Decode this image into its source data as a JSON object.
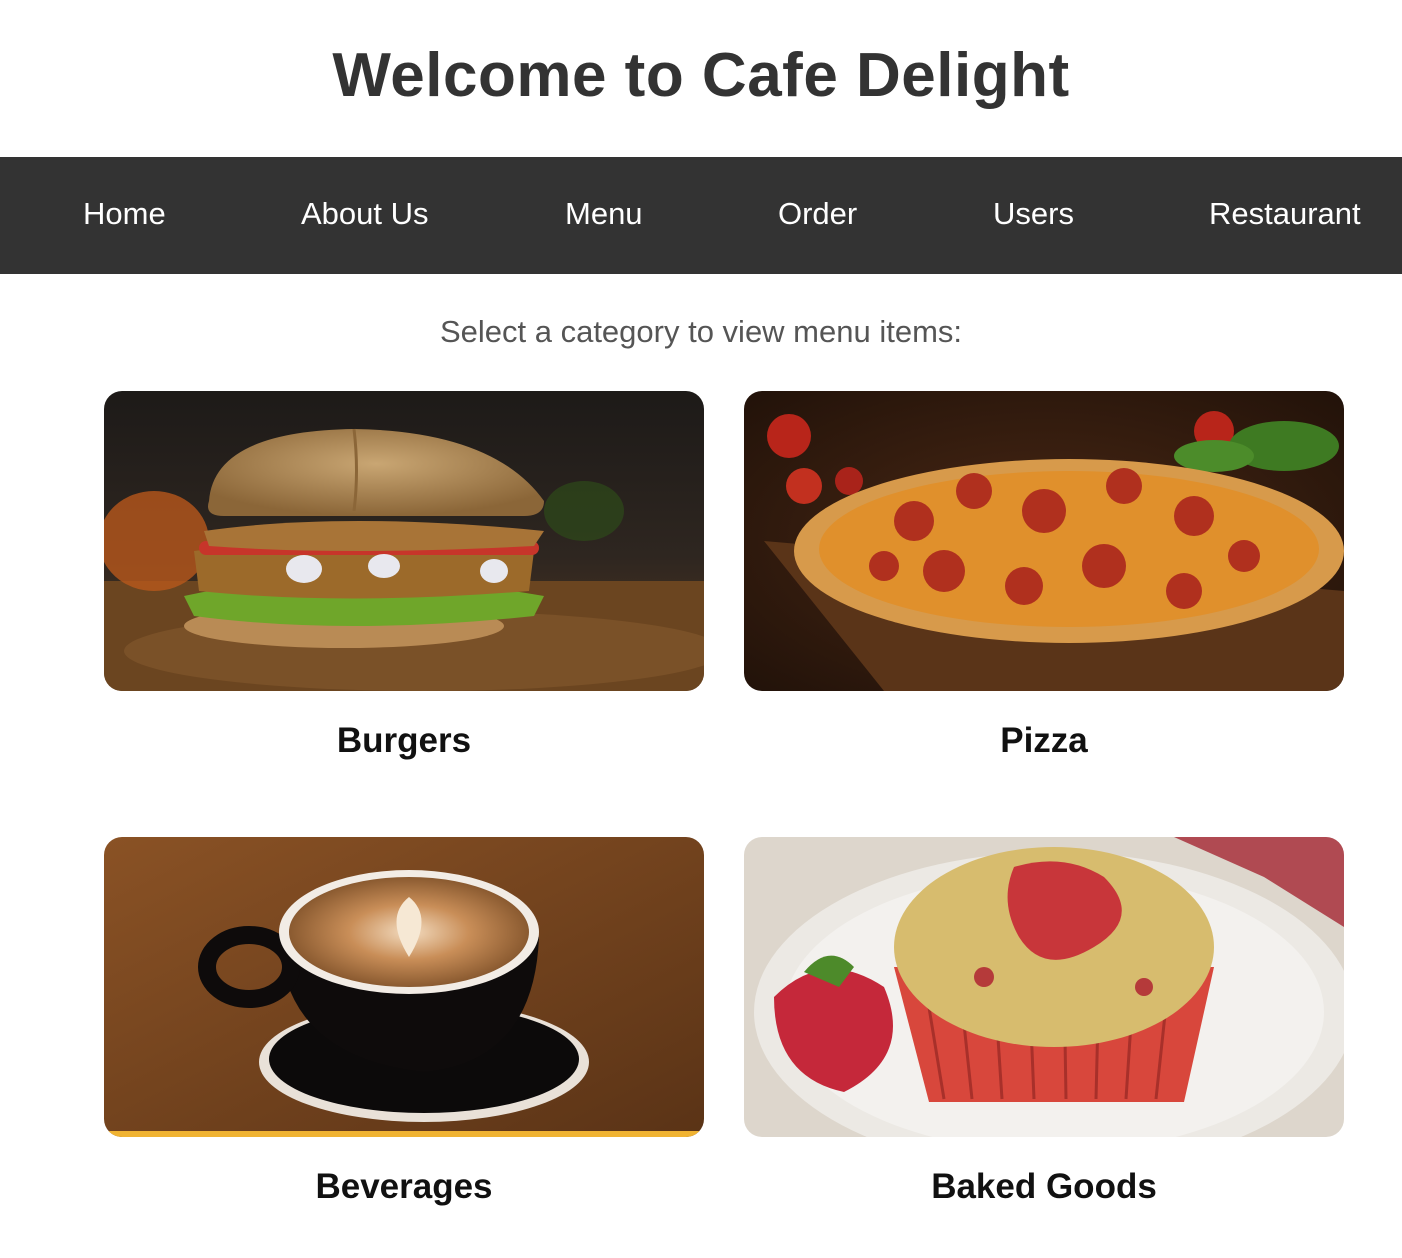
{
  "header": {
    "title": "Welcome to Cafe Delight"
  },
  "nav": {
    "items": [
      {
        "label": "Home"
      },
      {
        "label": "About Us"
      },
      {
        "label": "Menu"
      },
      {
        "label": "Order"
      },
      {
        "label": "Users"
      },
      {
        "label": "Restaurant"
      }
    ]
  },
  "main": {
    "prompt": "Select a category to view menu items:",
    "categories": [
      {
        "label": "Burgers",
        "image": "burger-photo"
      },
      {
        "label": "Pizza",
        "image": "pizza-photo"
      },
      {
        "label": "Beverages",
        "image": "coffee-photo"
      },
      {
        "label": "Baked Goods",
        "image": "muffin-photo"
      }
    ]
  },
  "colors": {
    "navbar": "#333333",
    "nav_text": "#ffffff",
    "title": "#333333"
  }
}
